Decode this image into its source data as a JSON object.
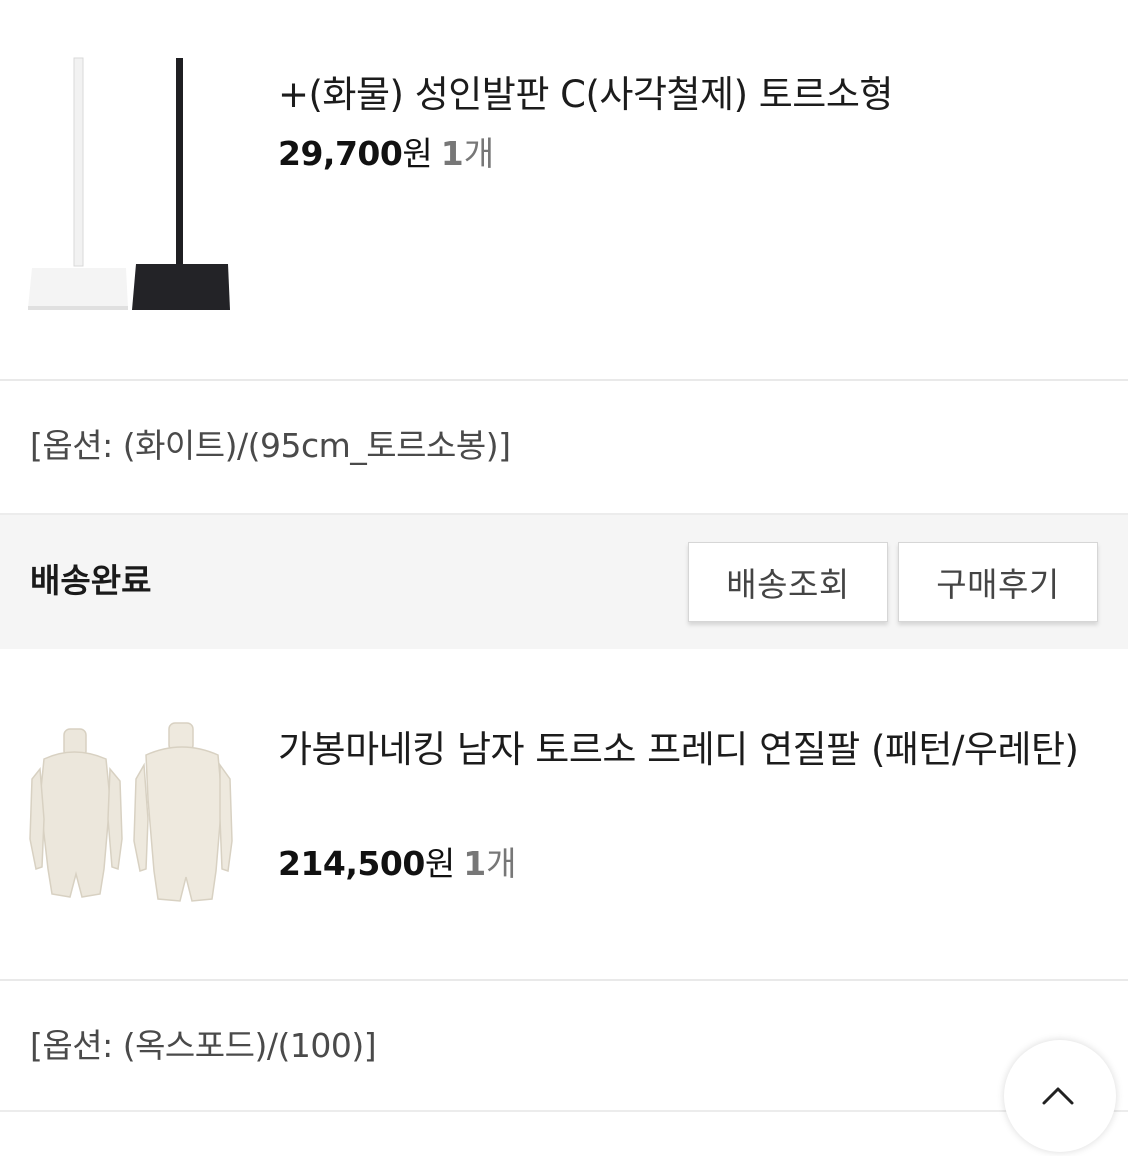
{
  "orders": [
    {
      "name": "+(화물) 성인발판 C(사각철제) 토르소형",
      "price": "29,700",
      "price_unit": "원",
      "qty": "1",
      "qty_unit": "개",
      "option": "[옵션: (화이트)/(95cm_토르소봉)]",
      "image_icon": "torso-stand-image"
    },
    {
      "name": "가봉마네킹 남자 토르소 프레디 연질팔 (패턴/우레탄)",
      "price": "214,500",
      "price_unit": "원",
      "qty": "1",
      "qty_unit": "개",
      "option": "[옵션: (옥스포드)/(100)]",
      "image_icon": "mannequin-image"
    }
  ],
  "shipment": {
    "status": "배송완료",
    "track_button": "배송조회",
    "review_button": "구매후기"
  },
  "floating": {
    "scroll_top_icon": "chevron-up-icon"
  }
}
